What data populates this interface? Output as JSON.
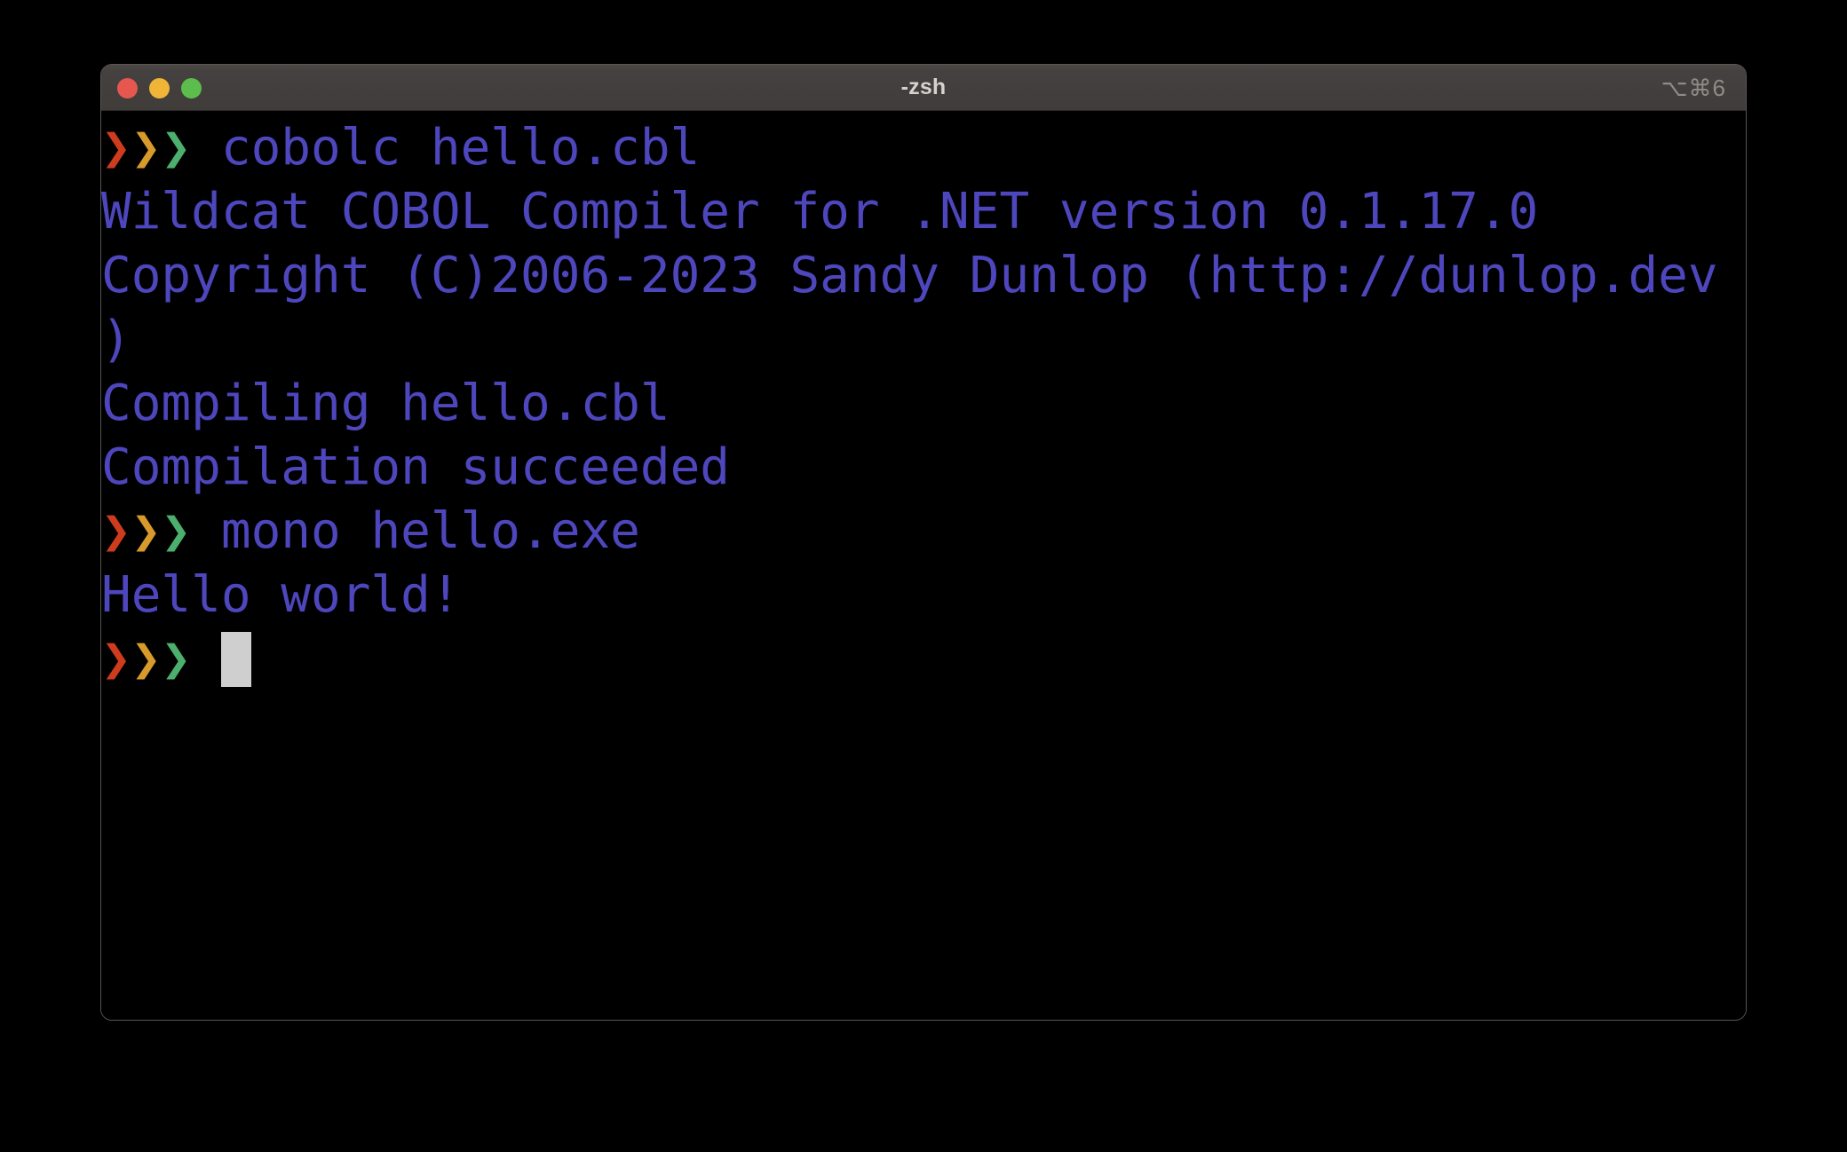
{
  "window": {
    "title": "-zsh",
    "shortcut": "⌥⌘6",
    "traffic_lights": {
      "close": "close-button",
      "minimize": "minimize-button",
      "maximize": "maximize-button"
    }
  },
  "colors": {
    "background": "#000000",
    "titlebar": "#433f3c",
    "text_purple": "#4e46bd",
    "chevron_red": "#cf3c1d",
    "chevron_amber": "#d79a2b",
    "chevron_green": "#4caf6d",
    "cursor": "#cfcfcf",
    "light_close": "#e6584f",
    "light_min": "#f0b437",
    "light_max": "#5cbd4d"
  },
  "terminal": {
    "prompt_symbol": "❯❯❯",
    "lines": [
      {
        "type": "prompt",
        "command": " cobolc hello.cbl"
      },
      {
        "type": "output",
        "text": "Wildcat COBOL Compiler for .NET version 0.1.17.0"
      },
      {
        "type": "output",
        "text": "Copyright (C)2006-2023 Sandy Dunlop (http://dunlop.dev"
      },
      {
        "type": "output",
        "text": ")"
      },
      {
        "type": "output",
        "text": "Compiling hello.cbl"
      },
      {
        "type": "output",
        "text": "Compilation succeeded"
      },
      {
        "type": "prompt",
        "command": " mono hello.exe"
      },
      {
        "type": "output",
        "text": "Hello world!"
      },
      {
        "type": "prompt_cursor",
        "command": " "
      }
    ]
  }
}
